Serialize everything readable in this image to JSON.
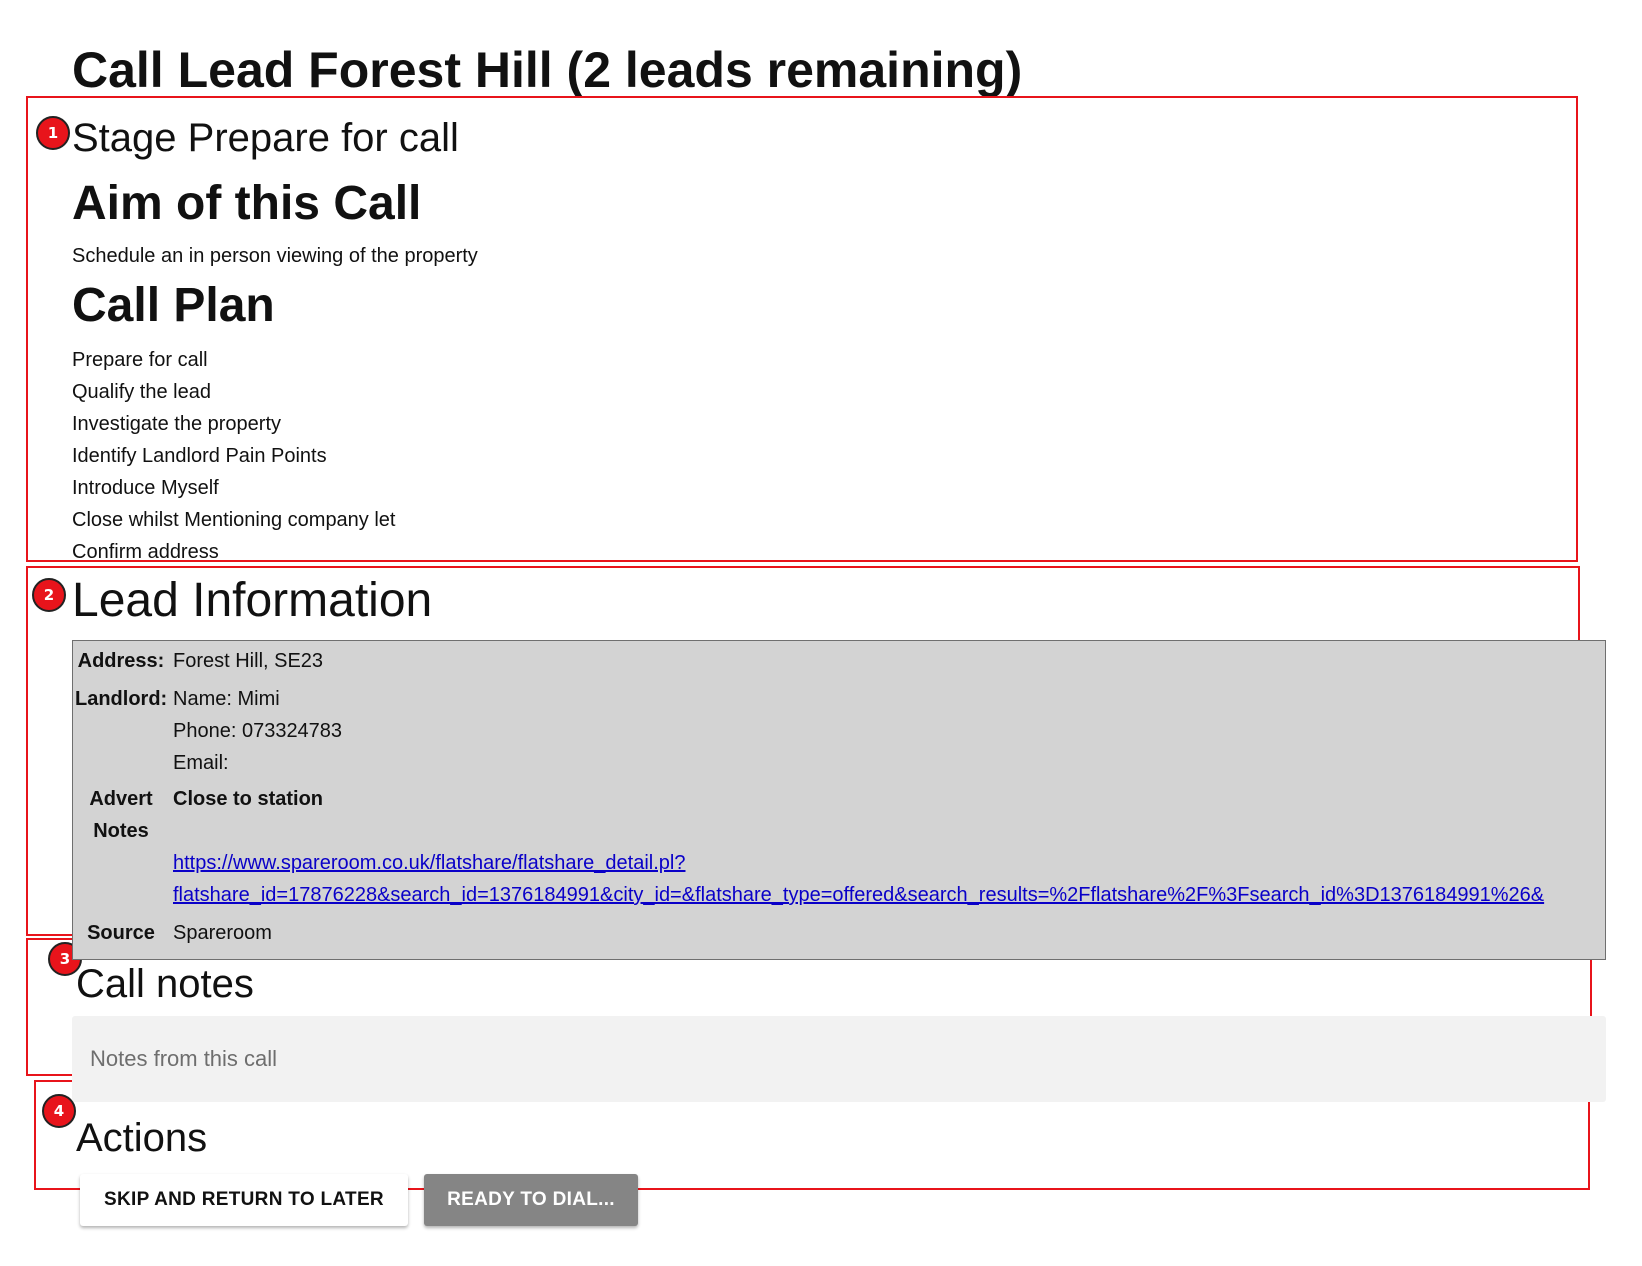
{
  "page": {
    "title": "Call Lead Forest Hill (2 leads remaining)"
  },
  "annotations": [
    "1",
    "2",
    "3",
    "4"
  ],
  "stage": {
    "heading": "Stage Prepare for call",
    "aim_heading": "Aim of this Call",
    "aim_text": "Schedule an in person viewing of the property",
    "plan_heading": "Call Plan",
    "plan_items": [
      "Prepare for call",
      "Qualify the lead",
      "Investigate the property",
      "Identify Landlord Pain Points",
      "Introduce Myself",
      "Close whilst Mentioning company let",
      "Confirm address"
    ]
  },
  "lead": {
    "heading": "Lead Information",
    "address_label": "Address:",
    "address_value": "Forest Hill, SE23",
    "landlord_label": "Landlord:",
    "landlord_name": "Name: Mimi",
    "landlord_phone": "Phone: 073324783",
    "landlord_email": "Email:",
    "advert_label_1": "Advert",
    "advert_label_2": "Notes",
    "advert_title": "Close to station",
    "advert_link_1": "https://www.spareroom.co.uk/flatshare/flatshare_detail.pl?",
    "advert_link_2": "flatshare_id=17876228&search_id=1376184991&city_id=&flatshare_type=offered&search_results=%2Fflatshare%2F%3Fsearch_id%3D1376184991%26&",
    "source_label": "Source",
    "source_value": "Spareroom"
  },
  "call_notes": {
    "heading": "Call notes",
    "placeholder": "Notes from this call",
    "value": ""
  },
  "actions": {
    "heading": "Actions",
    "skip_label": "SKIP AND RETURN TO LATER",
    "dial_label": "READY TO DIAL..."
  },
  "colors": {
    "annotation": "#e8141b",
    "table_bg": "#d3d3d3",
    "link": "#0a00c8",
    "dial_button": "#858585",
    "notes_bg": "#f2f2f2"
  }
}
